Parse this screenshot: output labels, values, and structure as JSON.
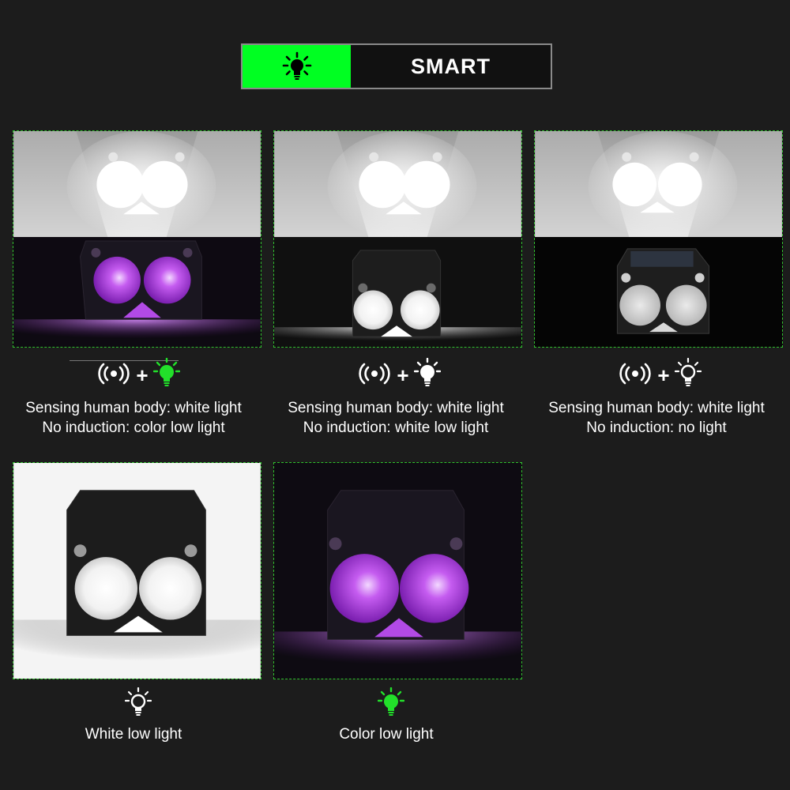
{
  "header": {
    "mode_icon": "bulb-rays-icon",
    "mode_label": "SMART",
    "accent_color": "#00ff22"
  },
  "modes": [
    {
      "icons": [
        "motion-sensor-icon",
        "bulb-icon-green"
      ],
      "line1": "Sensing human body: white light",
      "line2": "No induction: color low light"
    },
    {
      "icons": [
        "motion-sensor-icon",
        "bulb-icon-white-glow"
      ],
      "line1": "Sensing human body: white light",
      "line2": "No induction: white low light"
    },
    {
      "icons": [
        "motion-sensor-icon",
        "bulb-icon-outline"
      ],
      "line1": "Sensing human body: white light",
      "line2": "No induction: no light"
    },
    {
      "icons": [
        "bulb-icon-outline"
      ],
      "line1": "White low light"
    },
    {
      "icons": [
        "bulb-icon-green"
      ],
      "line1": "Color low light"
    }
  ],
  "colors": {
    "panel_border": "#31c12f",
    "purple_glow": "#b24ae6",
    "white_glow": "#ffffff"
  }
}
